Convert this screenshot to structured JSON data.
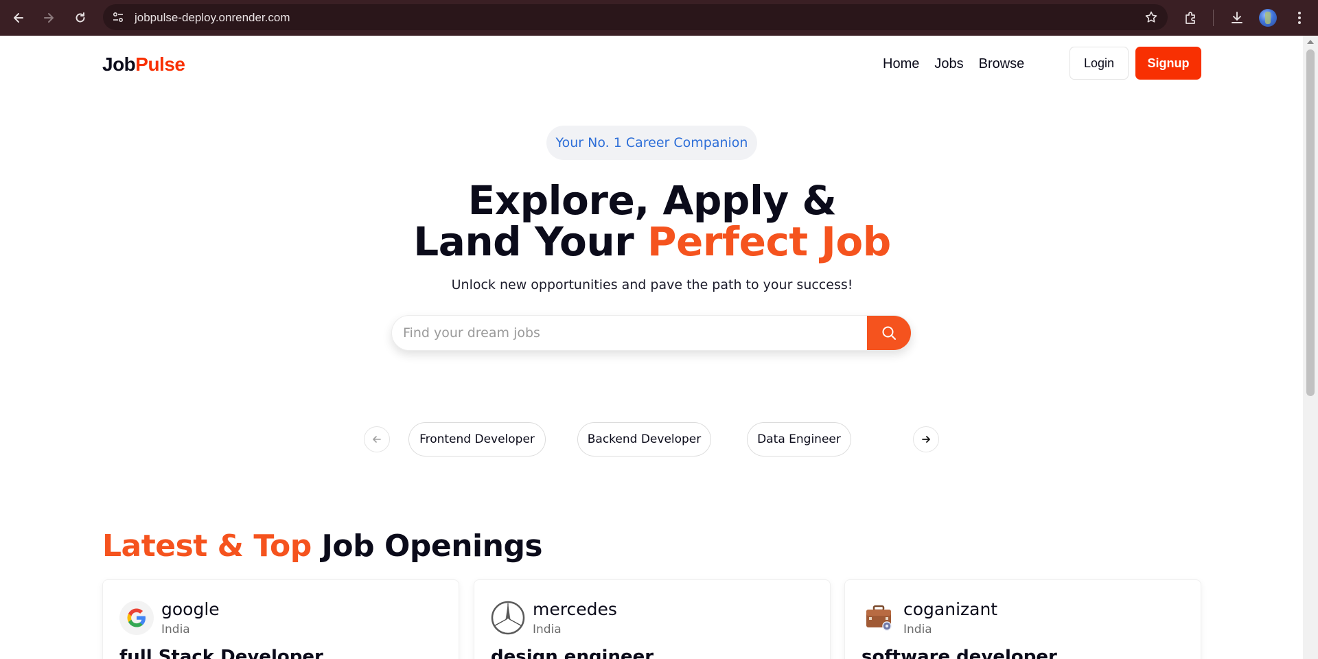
{
  "browser": {
    "url": "jobpulse-deploy.onrender.com",
    "icons": [
      "back-icon",
      "forward-icon",
      "reload-icon",
      "site-info-icon",
      "bookmark-star-icon",
      "extensions-icon",
      "downloads-icon",
      "profile-avatar",
      "menu-kebab-icon"
    ]
  },
  "header": {
    "logo_part1": "Job",
    "logo_part2": "Pulse",
    "nav": [
      "Home",
      "Jobs",
      "Browse"
    ],
    "login_label": "Login",
    "signup_label": "Signup"
  },
  "hero": {
    "badge": "Your No. 1 Career Companion",
    "title_line1": "Explore, Apply &",
    "title_line2_plain": "Land Your ",
    "title_line2_accent": "Perfect Job",
    "subtitle": "Unlock new opportunities and pave the path to your success!",
    "search_placeholder": "Find your dream jobs"
  },
  "categories": [
    "Frontend Developer",
    "Backend Developer",
    "Data Engineer"
  ],
  "latest": {
    "title_accent": "Latest & Top",
    "title_plain": " Job Openings",
    "jobs": [
      {
        "company": "google",
        "location": "India",
        "role": "full Stack Developer"
      },
      {
        "company": "mercedes",
        "location": "India",
        "role": "design engineer"
      },
      {
        "company": "coganizant",
        "location": "India",
        "role": "software developer"
      }
    ]
  },
  "colors": {
    "brand": "#f83002",
    "accent": "#f5531e",
    "badge_text": "#2e6fd8",
    "chrome_bg": "#3a1f24"
  }
}
